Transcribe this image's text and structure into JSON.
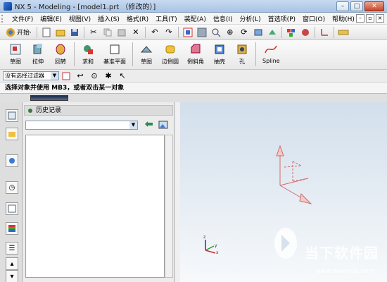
{
  "window": {
    "title": "NX 5 - Modeling - [model1.prt （修改的）]",
    "min_label": "–",
    "max_label": "□",
    "close_label": "✕"
  },
  "menu": {
    "items": [
      "文件(F)",
      "编辑(E)",
      "视图(V)",
      "插入(S)",
      "格式(R)",
      "工具(T)",
      "装配(A)",
      "信息(I)",
      "分析(L)",
      "首选项(P)",
      "窗口(O)",
      "帮助(H)"
    ]
  },
  "toolbar_standard": {
    "start_label": "开始·",
    "icons": [
      "new-icon",
      "open-icon",
      "save-icon",
      "cut-icon",
      "copy-icon",
      "paste-icon",
      "delete-icon",
      "undo-icon",
      "redo-icon",
      "fit-icon",
      "zoom-icon",
      "pan-icon",
      "rotate-icon",
      "orient-icon",
      "render-icon",
      "layer-icon",
      "wcs-icon"
    ]
  },
  "toolbar_features": {
    "tools": [
      {
        "label": "草图",
        "icon": "sketch-icon"
      },
      {
        "label": "拉伸",
        "icon": "extrude-icon"
      },
      {
        "label": "回转",
        "icon": "revolve-icon"
      },
      {
        "label": "求和",
        "icon": "unite-icon"
      },
      {
        "label": "基准平面",
        "icon": "datum-plane-icon"
      },
      {
        "label": "草图",
        "icon": "sketch-icon-2"
      },
      {
        "label": "边倒圆",
        "icon": "edge-blend-icon"
      },
      {
        "label": "倒斜角",
        "icon": "chamfer-icon"
      },
      {
        "label": "抽壳",
        "icon": "shell-icon"
      },
      {
        "label": "孔",
        "icon": "hole-icon"
      },
      {
        "label": "Spline",
        "icon": "spline-icon"
      }
    ]
  },
  "selection": {
    "filter_value": "没有选择过滤器"
  },
  "status": {
    "prompt": "选择对象并使用 MB3，或者双击某一对象"
  },
  "history_panel": {
    "title": "历史记录"
  },
  "watermark": {
    "brand": "当下软件园",
    "url": "www.downxia.com"
  },
  "colors": {
    "accent": "#3a7bd5",
    "wcs": "#d46a6a",
    "graphics_bg_top": "#d2dfec"
  }
}
